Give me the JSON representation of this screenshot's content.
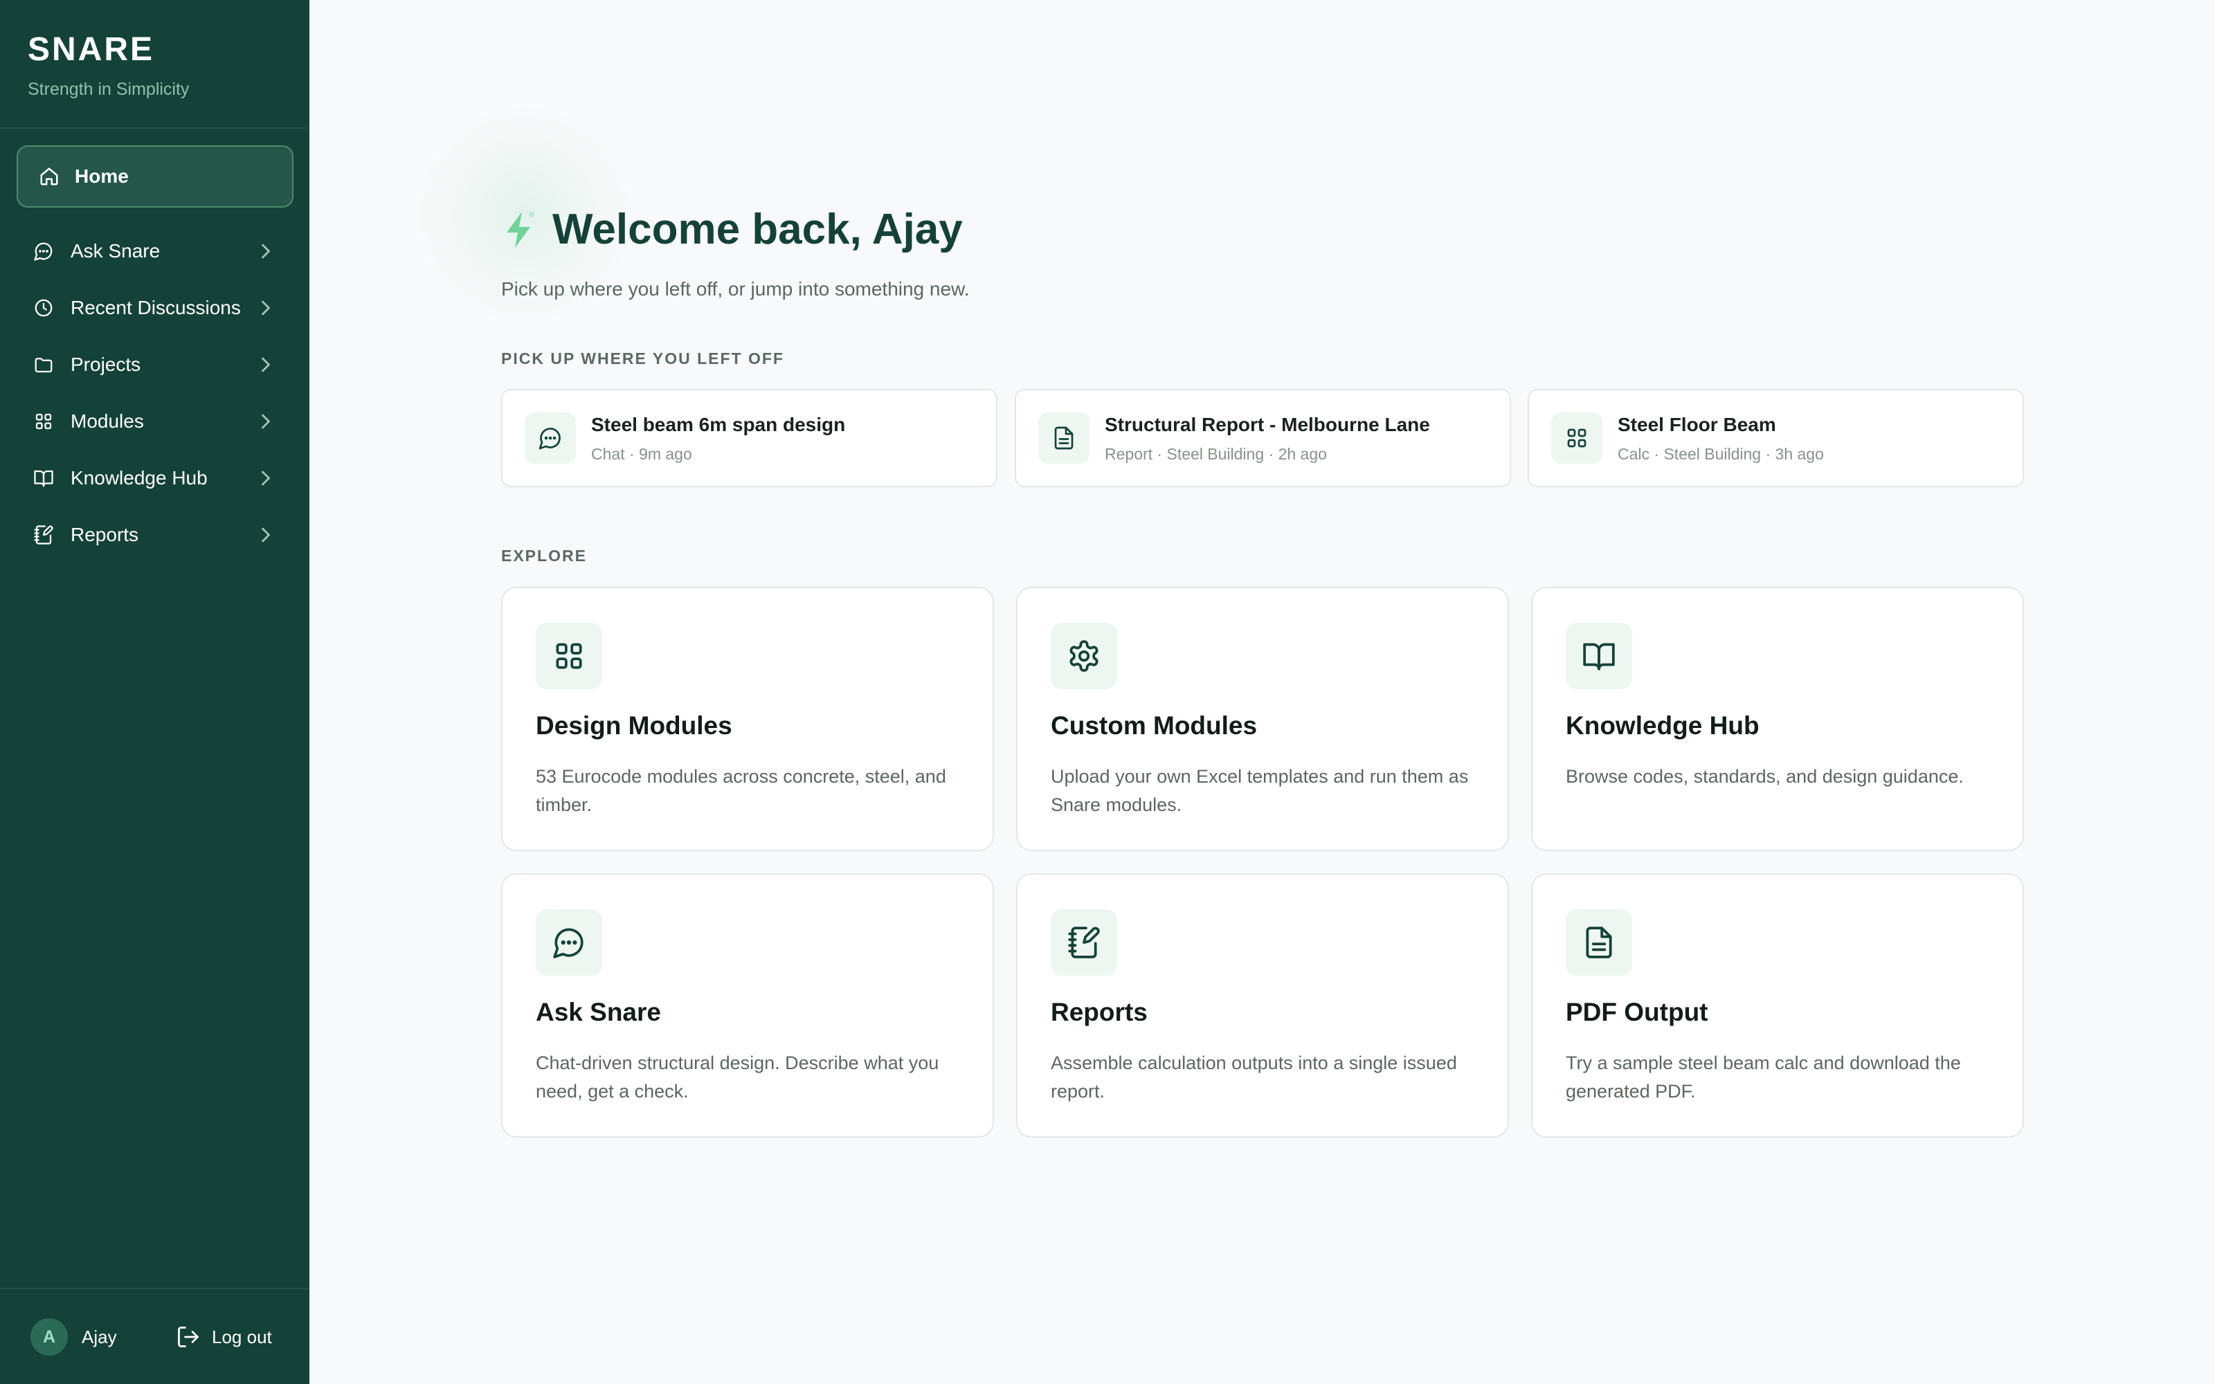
{
  "app": {
    "name": "SNARE",
    "tagline": "Strength in Simplicity"
  },
  "sidebar": {
    "home": {
      "label": "Home",
      "icon": "home-icon",
      "active": true
    },
    "items": [
      {
        "label": "Ask Snare",
        "icon": "chat-icon"
      },
      {
        "label": "Recent Discussions",
        "icon": "clock-icon"
      },
      {
        "label": "Projects",
        "icon": "folder-icon"
      },
      {
        "label": "Modules",
        "icon": "grid-icon"
      },
      {
        "label": "Knowledge Hub",
        "icon": "book-icon"
      },
      {
        "label": "Reports",
        "icon": "notebook-pen-icon"
      }
    ],
    "user": {
      "initial": "A",
      "name": "Ajay"
    },
    "logout_label": "Log out"
  },
  "main": {
    "welcome_title": "Welcome back, Ajay",
    "welcome_subtitle": "Pick up where you left off, or jump into something new.",
    "recent_section_label": "PICK UP WHERE YOU LEFT OFF",
    "recent": [
      {
        "title": "Steel beam 6m span design",
        "meta": "Chat · 9m ago",
        "icon": "chat-icon"
      },
      {
        "title": "Structural Report - Melbourne Lane",
        "meta": "Report · Steel Building · 2h ago",
        "icon": "document-icon"
      },
      {
        "title": "Steel Floor Beam",
        "meta": "Calc · Steel Building · 3h ago",
        "icon": "grid-icon"
      }
    ],
    "explore_section_label": "EXPLORE",
    "explore": [
      {
        "title": "Design Modules",
        "description": "53 Eurocode modules across concrete, steel, and timber.",
        "icon": "grid-icon"
      },
      {
        "title": "Custom Modules",
        "description": "Upload your own Excel templates and run them as Snare modules.",
        "icon": "gear-icon"
      },
      {
        "title": "Knowledge Hub",
        "description": "Browse codes, standards, and design guidance.",
        "icon": "book-icon"
      },
      {
        "title": "Ask Snare",
        "description": "Chat-driven structural design. Describe what you need, get a check.",
        "icon": "chat-icon"
      },
      {
        "title": "Reports",
        "description": "Assemble calculation outputs into a single issued report.",
        "icon": "notebook-pen-icon"
      },
      {
        "title": "PDF Output",
        "description": "Try a sample steel beam calc and download the generated PDF.",
        "icon": "document-icon"
      }
    ]
  },
  "colors": {
    "sidebar_bg": "#154238",
    "accent": "#154238",
    "icon_tile_bg": "#edf6f1",
    "bolt": "#6fd39a",
    "page_bg": "#f8f9fa"
  }
}
